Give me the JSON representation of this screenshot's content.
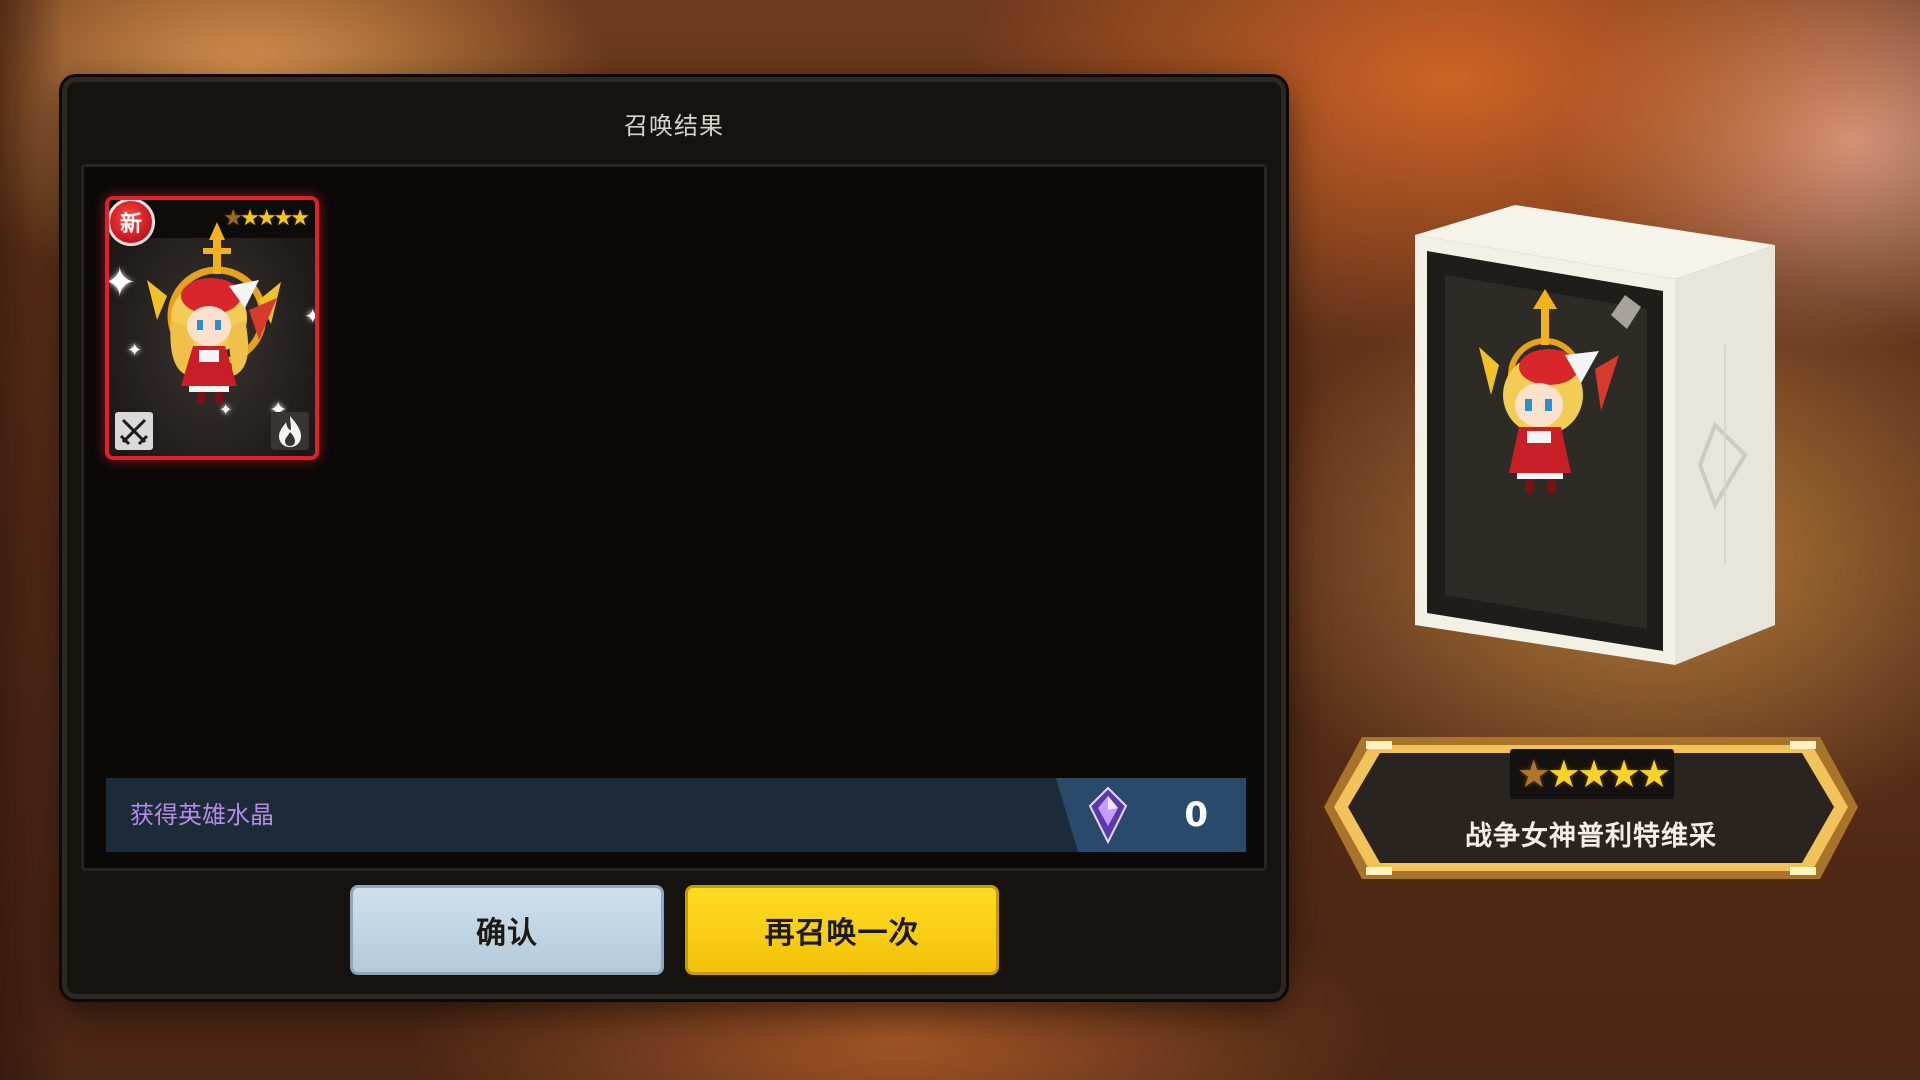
{
  "dialog": {
    "title": "召唤结果",
    "card": {
      "badge": "新",
      "stars_filled": 4,
      "stars_total": 5,
      "class_icon": "sword-icon",
      "element_icon": "fire-icon"
    },
    "crystal": {
      "label": "获得英雄水晶",
      "count": "0",
      "icon": "crystal-icon"
    },
    "buttons": {
      "confirm": "确认",
      "resummon": "再召唤一次"
    }
  },
  "showcase": {
    "hero_name": "战争女神普利特维采",
    "stars_filled": 4,
    "stars_total": 5
  },
  "colors": {
    "card_border": "#e0202a",
    "resummon_button": "#f2c10a",
    "confirm_button": "#b4cada",
    "crystal_label": "#b58be8",
    "crystal_bar": "#1d2a38"
  }
}
